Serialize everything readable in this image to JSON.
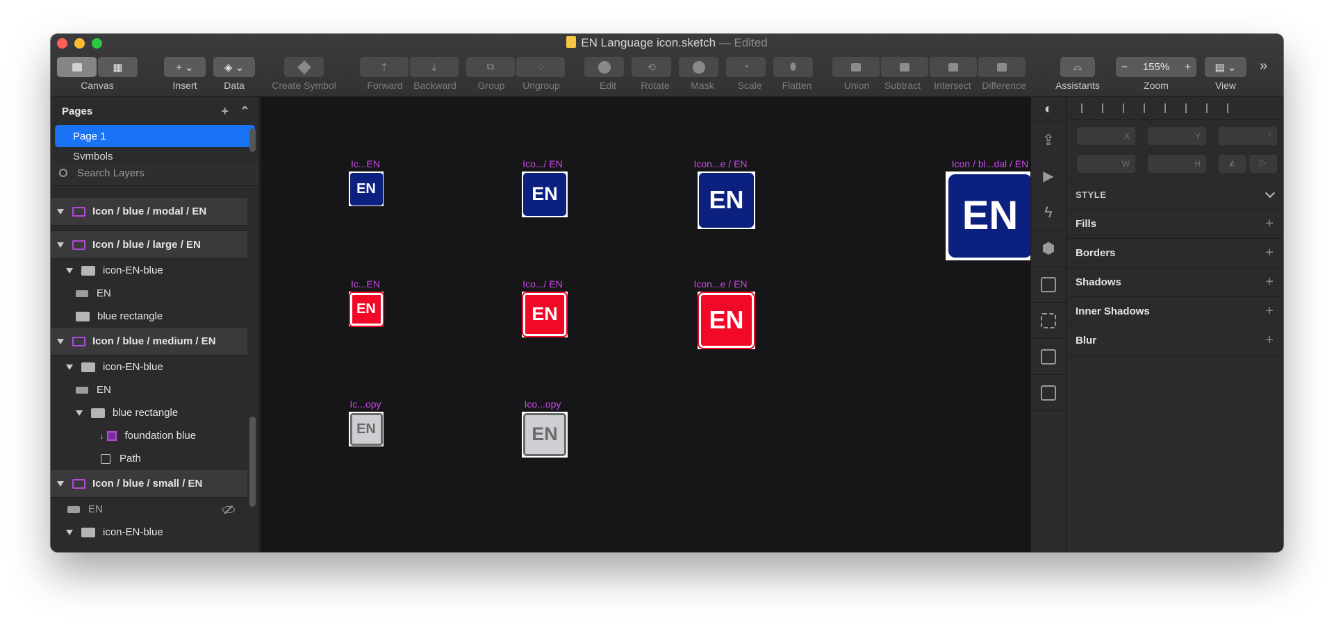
{
  "window": {
    "title": "EN Language icon.sketch",
    "status": "— Edited"
  },
  "toolbar": {
    "canvas": "Canvas",
    "insert": "Insert",
    "data": "Data",
    "create_symbol": "Create Symbol",
    "forward": "Forward",
    "backward": "Backward",
    "group": "Group",
    "ungroup": "Ungroup",
    "edit": "Edit",
    "rotate": "Rotate",
    "mask": "Mask",
    "scale": "Scale",
    "flatten": "Flatten",
    "union": "Union",
    "subtract": "Subtract",
    "intersect": "Intersect",
    "difference": "Difference",
    "assistants": "Assistants",
    "zoom_label": "Zoom",
    "zoom_value": "155%",
    "zoom_minus": "−",
    "zoom_plus": "+",
    "view": "View",
    "overflow": "»"
  },
  "pages": {
    "header": "Pages",
    "add": "+",
    "collapse": "⌃",
    "items": [
      "Page 1",
      "Symbols"
    ]
  },
  "search": {
    "placeholder": "Search Layers"
  },
  "layers": [
    {
      "label": "Icon / blue / modal / EN"
    },
    {
      "label": "Icon / blue / large / EN"
    },
    {
      "label": "icon-EN-blue"
    },
    {
      "label": "EN"
    },
    {
      "label": "blue rectangle"
    },
    {
      "label": "Icon / blue / medium / EN"
    },
    {
      "label": "icon-EN-blue"
    },
    {
      "label": "EN"
    },
    {
      "label": "blue rectangle"
    },
    {
      "label": "foundation blue"
    },
    {
      "label": "Path"
    },
    {
      "label": "Icon / blue / small / EN"
    },
    {
      "label": "EN"
    },
    {
      "label": "icon-EN-blue"
    }
  ],
  "canvas": {
    "artboards": [
      {
        "label": "Ic...EN",
        "text": "EN"
      },
      {
        "label": "Ico.../ EN",
        "text": "EN"
      },
      {
        "label": "Icon...e / EN",
        "text": "EN"
      },
      {
        "label": "Icon / bl...dal / EN",
        "text": "EN"
      },
      {
        "label": "Ic...EN",
        "text": "EN"
      },
      {
        "label": "Ico.../ EN",
        "text": "EN"
      },
      {
        "label": "Icon...e / EN",
        "text": "EN"
      },
      {
        "label": "Ic...opy",
        "text": "EN"
      },
      {
        "label": "Ico...opy",
        "text": "EN"
      }
    ]
  },
  "inspector": {
    "fields": [
      "X",
      "Y",
      "°",
      "W",
      "H"
    ],
    "style": "STYLE",
    "fills": "Fills",
    "borders": "Borders",
    "shadows": "Shadows",
    "inner_shadows": "Inner Shadows",
    "blur": "Blur",
    "plus": "+"
  },
  "colors": {
    "accent": "#1a73f5",
    "artboard_label": "#c94ce8",
    "icon_blue": "#0c2080",
    "icon_red": "#f00a27",
    "icon_grey": "#cfcfd3"
  }
}
